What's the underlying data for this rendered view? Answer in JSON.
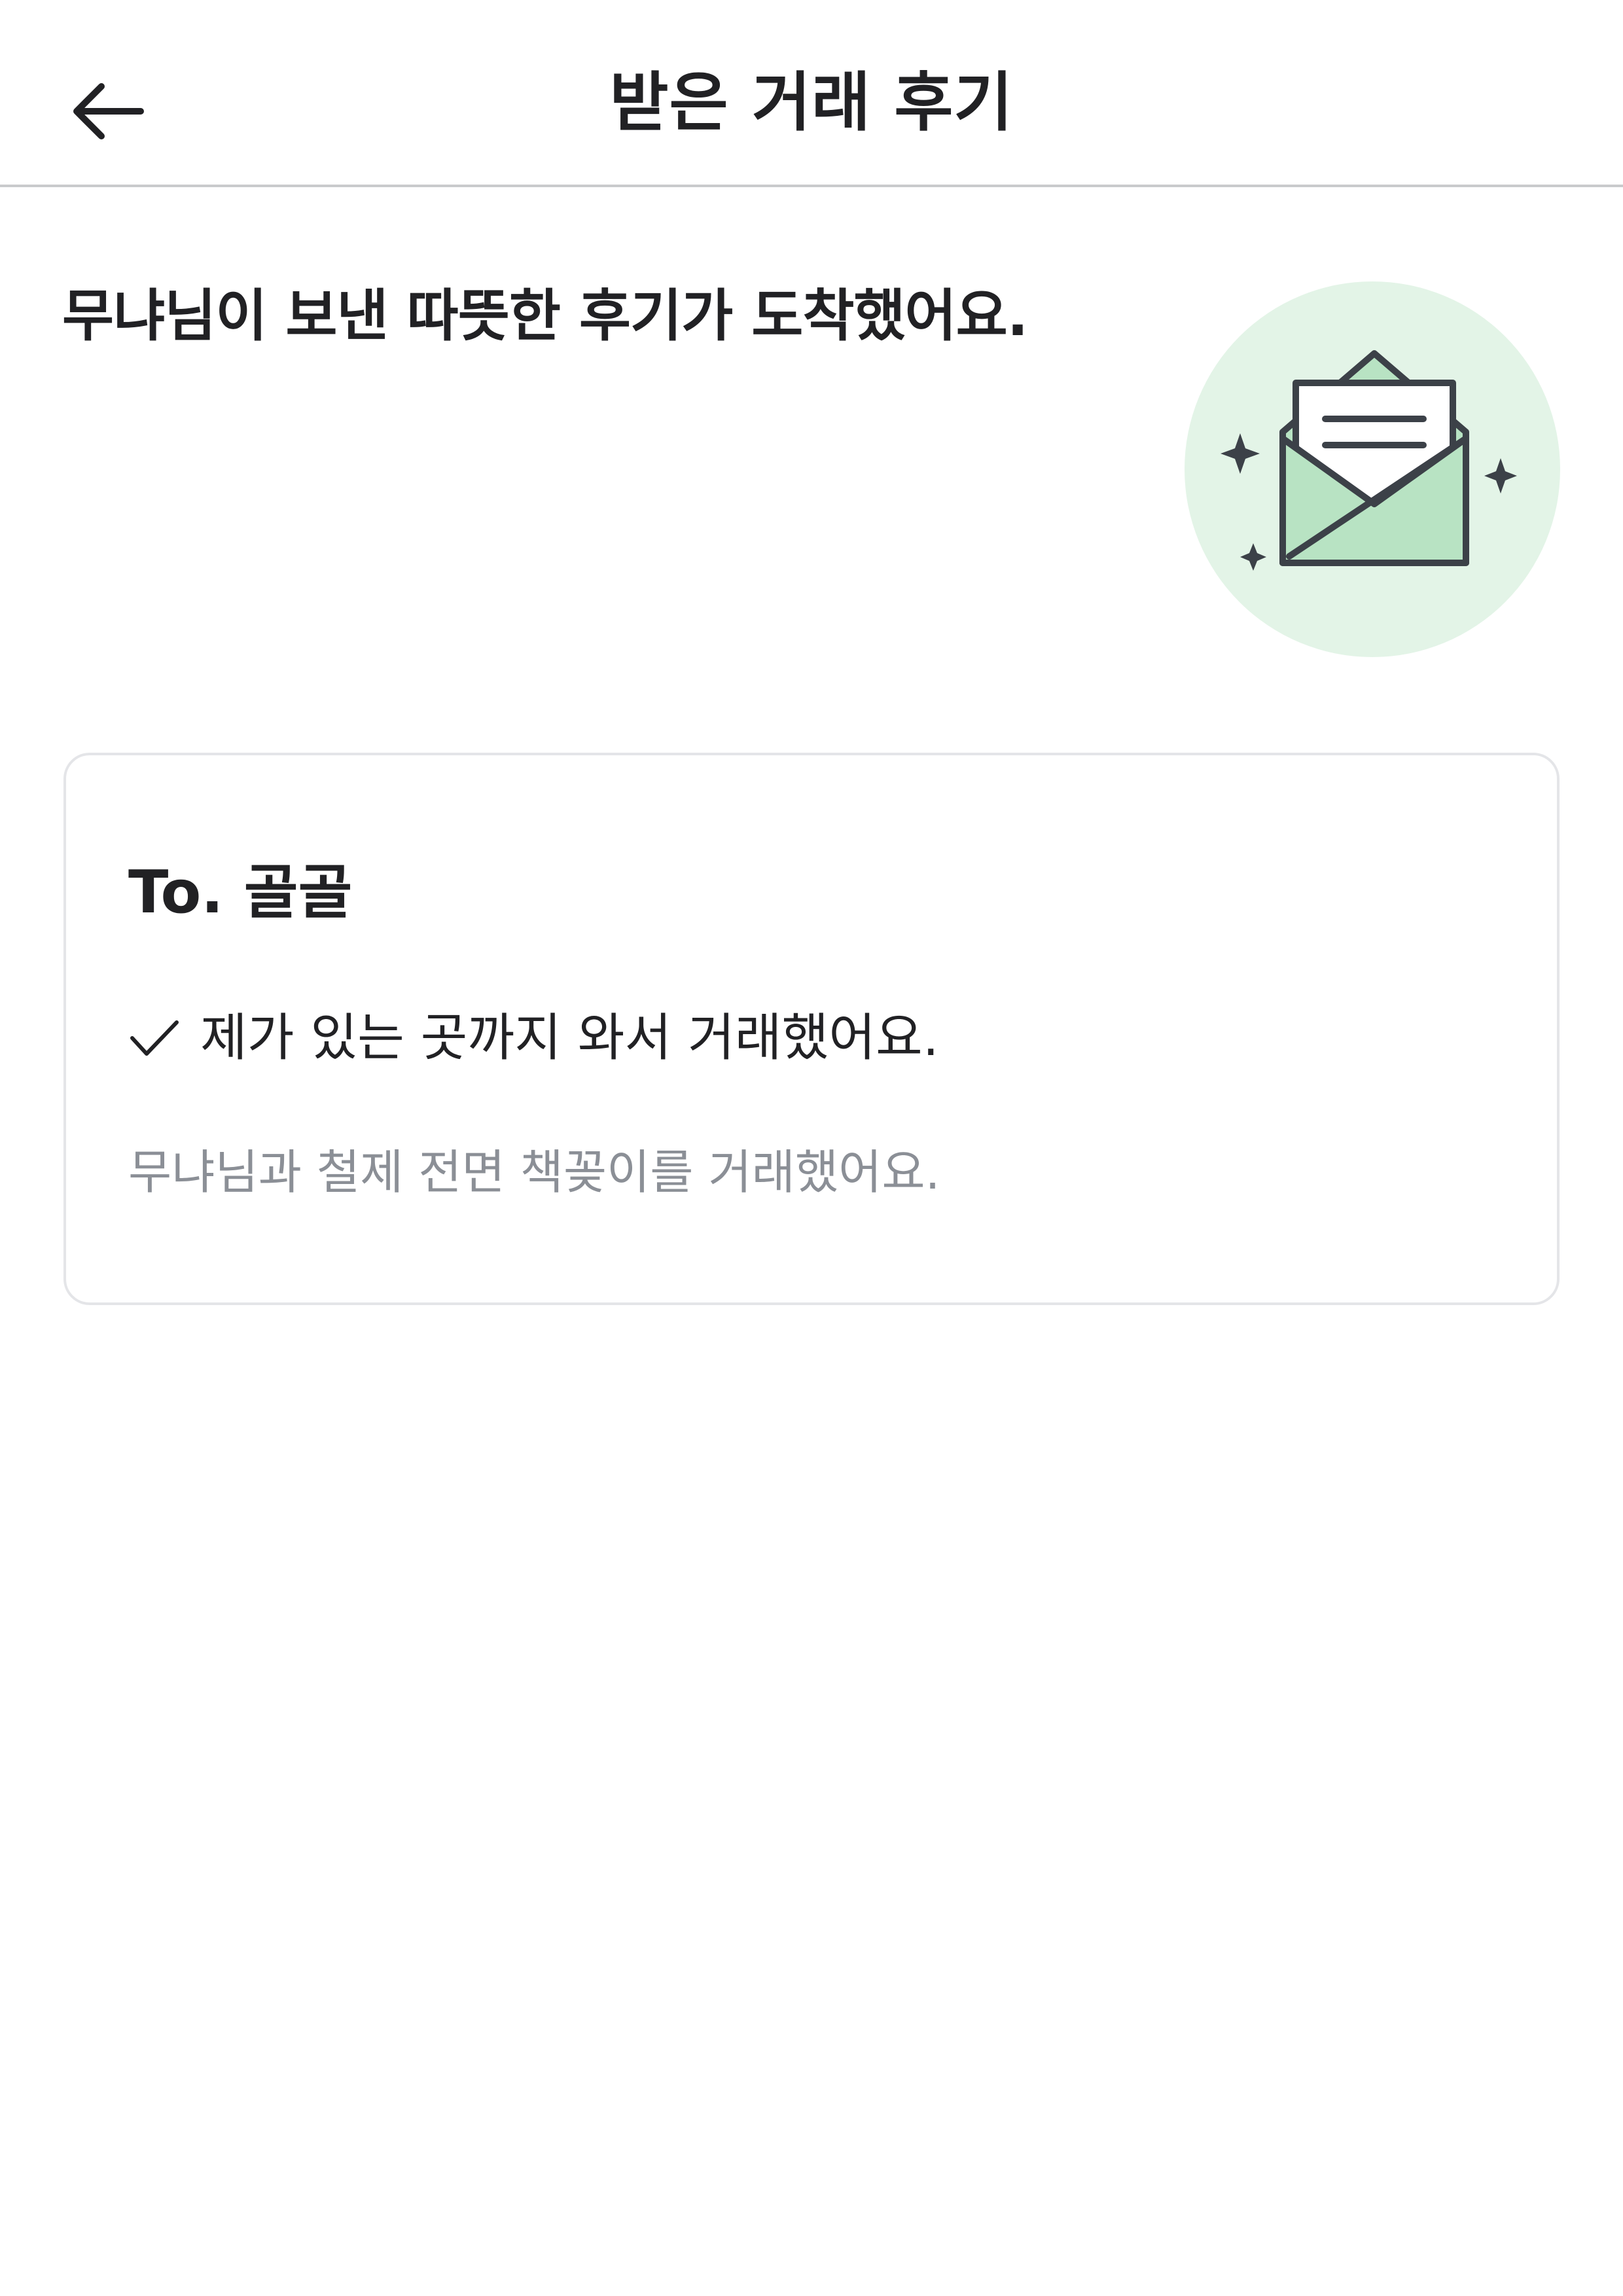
{
  "header": {
    "title": "받은 거래 후기",
    "back_icon": "arrow-left-icon"
  },
  "main": {
    "headline": "무냐님이 보낸 따뜻한 후기가 도착했어요.",
    "illustration_icon": "open-envelope-icon",
    "colors": {
      "illustration_bg": "#e3f4e7",
      "envelope_fill": "#b8e3c3",
      "line": "#3c4148"
    }
  },
  "review_card": {
    "to_label": "To. 골골",
    "check_icon": "checkmark-icon",
    "item_text": "제가 있는 곳까지 와서 거래했어요.",
    "note": "무냐님과 철제 전면 책꽂이를 거래했어요."
  }
}
